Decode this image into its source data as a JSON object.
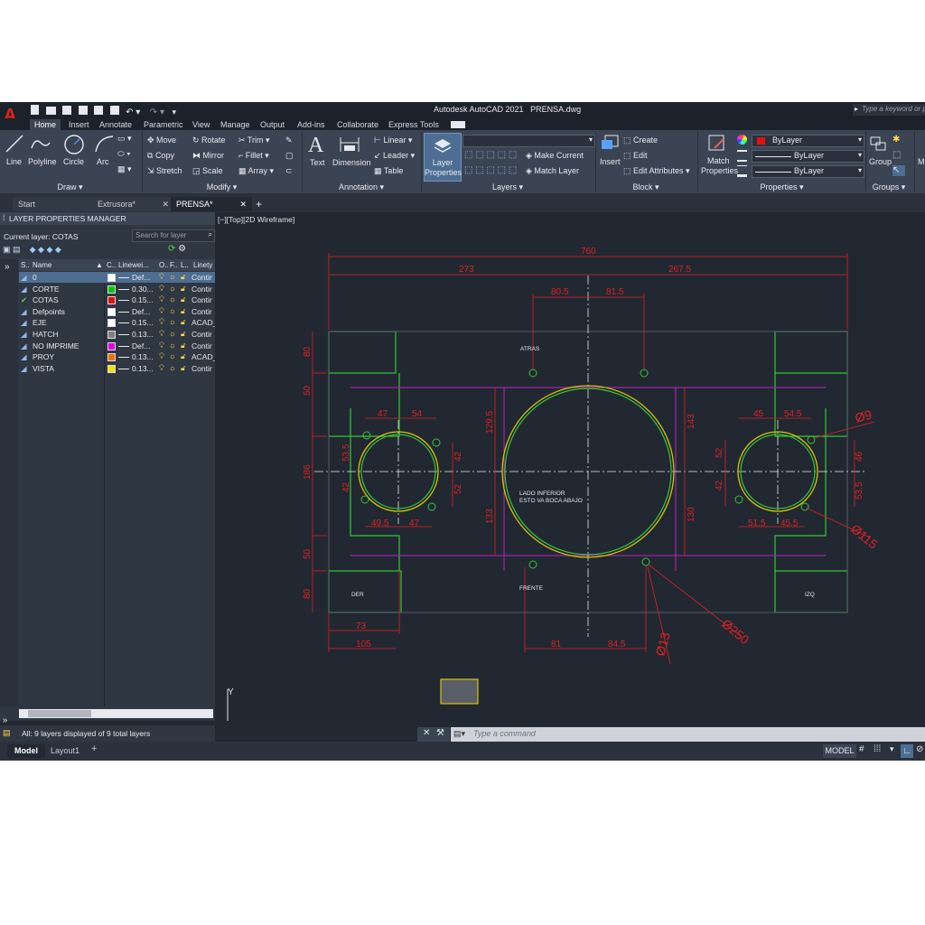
{
  "app_title": "Autodesk AutoCAD 2021",
  "file_title": "PRENSA.dwg",
  "search_placeholder": "Type a keyword or phr",
  "ribbon_tabs": [
    "Home",
    "Insert",
    "Annotate",
    "Parametric",
    "View",
    "Manage",
    "Output",
    "Add-ins",
    "Collaborate",
    "Express Tools"
  ],
  "draw": {
    "line": "Line",
    "polyline": "Polyline",
    "circle": "Circle",
    "arc": "Arc",
    "title": "Draw ▾"
  },
  "modify": {
    "move": "Move",
    "rotate": "Rotate",
    "trim": "Trim ▾",
    "copy": "Copy",
    "mirror": "Mirror",
    "fillet": "Fillet ▾",
    "stretch": "Stretch",
    "scale": "Scale",
    "array": "Array ▾",
    "title": "Modify ▾"
  },
  "annotation": {
    "text": "Text",
    "dimension": "Dimension",
    "linear": "Linear ▾",
    "leader": "Leader ▾",
    "table": "Table",
    "title": "Annotation ▾"
  },
  "layers": {
    "layer_properties_1": "Layer",
    "layer_properties_2": "Properties",
    "make_current": "Make Current",
    "match_layer": "Match Layer",
    "title": "Layers ▾"
  },
  "block": {
    "insert": "Insert",
    "create": "Create",
    "edit": "Edit",
    "edit_attributes": "Edit Attributes ▾",
    "title": "Block ▾"
  },
  "properties": {
    "match_1": "Match",
    "match_2": "Properties",
    "color": "ByLayer",
    "linetype": "ByLayer",
    "lineweight": "ByLayer",
    "title": "Properties ▾"
  },
  "groups": {
    "group": "Group",
    "title": "Groups ▾"
  },
  "file_tabs": [
    "Start",
    "Extrusora*",
    "PRENSA*"
  ],
  "lpm": {
    "title": "LAYER PROPERTIES MANAGER",
    "current_layer": "Current layer: COTAS",
    "search_placeholder": "Search for layer",
    "headers": [
      "S..",
      "Name",
      "C..",
      "Linewei...",
      "O..",
      "F..",
      "L..",
      "Linety"
    ],
    "layers": [
      {
        "name": "0",
        "color": "#ffffff",
        "lw": "Def...",
        "lt": "Contir"
      },
      {
        "name": "CORTE",
        "color": "#00c800",
        "lw": "0.30...",
        "lt": "Contir"
      },
      {
        "name": "COTAS",
        "color": "#e01010",
        "lw": "0.15...",
        "lt": "Contir"
      },
      {
        "name": "Defpoints",
        "color": "#ffffff",
        "lw": "Def...",
        "lt": "Contir"
      },
      {
        "name": "EJE",
        "color": "#ffffff",
        "lw": "0.15...",
        "lt": "ACAD_"
      },
      {
        "name": "HATCH",
        "color": "#808080",
        "lw": "0.13...",
        "lt": "Contir"
      },
      {
        "name": "NO IMPRIME",
        "color": "#e000e0",
        "lw": "Def...",
        "lt": "Contir"
      },
      {
        "name": "PROY",
        "color": "#f07000",
        "lw": "0.13...",
        "lt": "ACAD_"
      },
      {
        "name": "VISTA",
        "color": "#f0e000",
        "lw": "0.13...",
        "lt": "Contir"
      }
    ],
    "status": "All: 9 layers displayed of 9 total layers"
  },
  "viewport_label": "[−][Top][2D Wireframe]",
  "drawing": {
    "dims_top": [
      "760",
      "273",
      "267.5",
      "80.5",
      "81.5"
    ],
    "dims_left": [
      "80",
      "50",
      "186",
      "50",
      "80"
    ],
    "dims_left_hole": [
      "47",
      "54",
      "53.5",
      "42",
      "49.5",
      "47",
      "42",
      "52"
    ],
    "dims_center": [
      "129.5",
      "143",
      "133",
      "130"
    ],
    "dims_right_hole": [
      "45",
      "54.5",
      "52",
      "42",
      "51.5",
      "45.5",
      "53.5",
      "46"
    ],
    "dims_bottom": [
      "73",
      "105",
      "81",
      "84.5"
    ],
    "callouts": [
      "Ø9",
      "Ø115",
      "Ø250",
      "Ø13"
    ],
    "texts": {
      "atras": "ATRAS",
      "frente": "FRENTE",
      "der": "DER",
      "izq": "IZQ",
      "lado1": "LADO INFERIOR",
      "lado2": "ESTO VA BOCA ABAJO"
    }
  },
  "command_placeholder": "Type a command",
  "layout_tabs": [
    "Model",
    "Layout1"
  ],
  "status_model": "MODEL"
}
